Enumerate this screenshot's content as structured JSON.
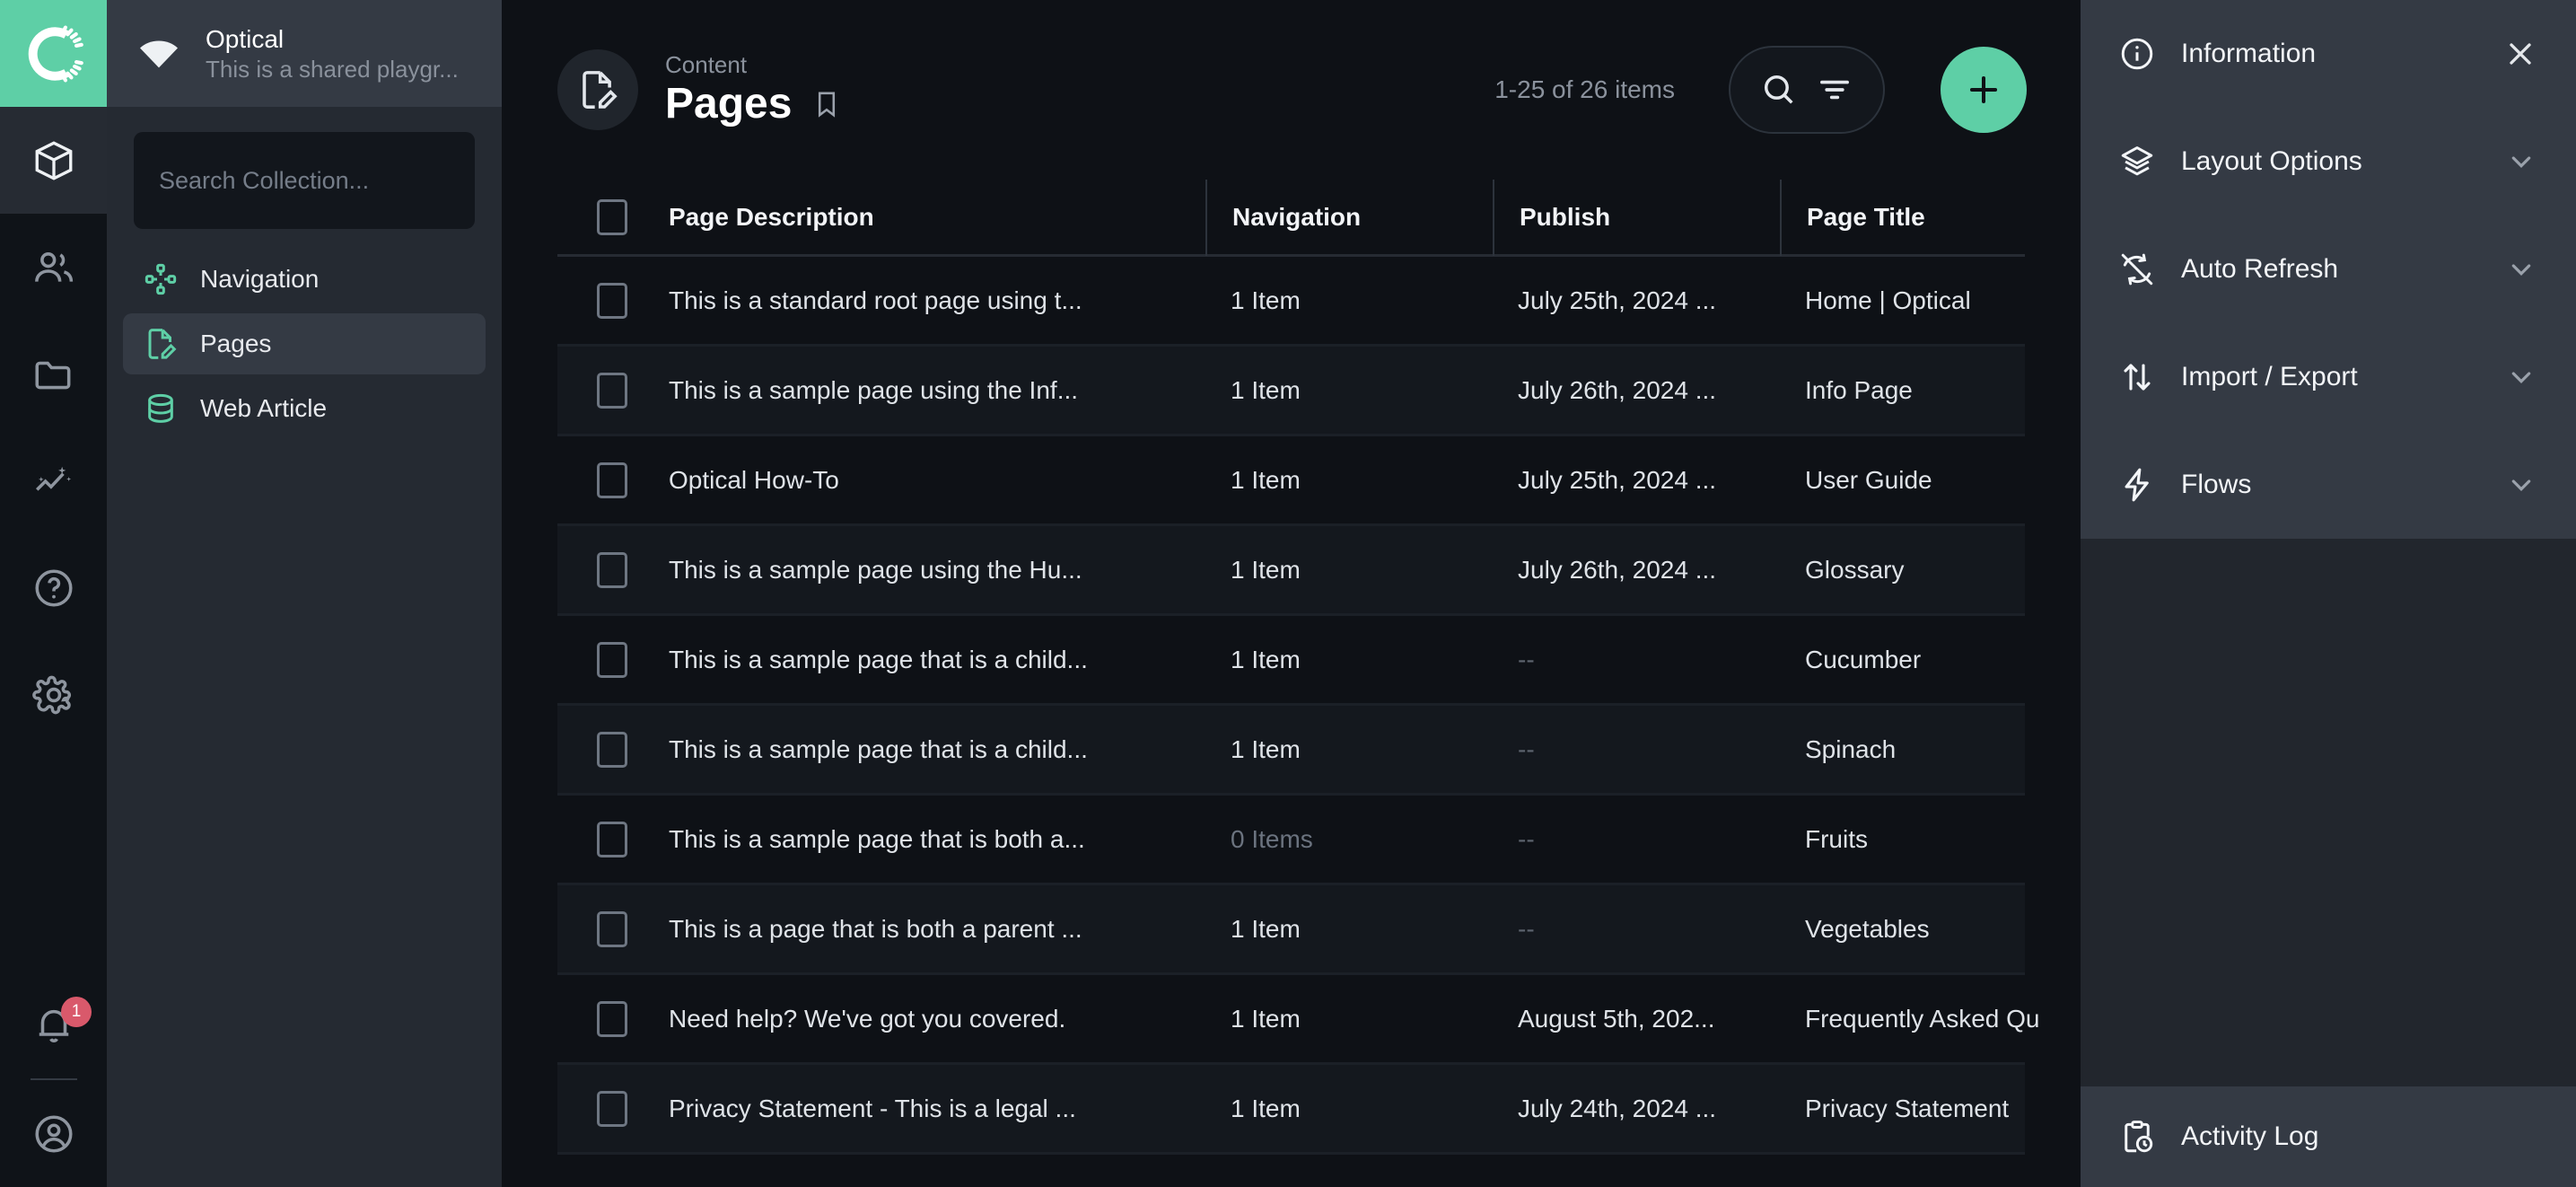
{
  "brand": {
    "logo_icon": "optical-ring-logo",
    "accent": "#5ecfa6"
  },
  "rail": {
    "items": [
      {
        "icon": "cube-icon",
        "name": "sidebar-item-collections",
        "active": true
      },
      {
        "icon": "users-icon",
        "name": "sidebar-item-users",
        "active": false
      },
      {
        "icon": "folder-icon",
        "name": "sidebar-item-files",
        "active": false
      },
      {
        "icon": "insights-icon",
        "name": "sidebar-item-insights",
        "active": false
      },
      {
        "icon": "help-circle-icon",
        "name": "sidebar-item-help",
        "active": false
      },
      {
        "icon": "gear-icon",
        "name": "sidebar-item-settings",
        "active": false
      }
    ],
    "notification_badge": "1",
    "notification_icon": "bell-icon",
    "account_icon": "account-circle-icon"
  },
  "sidebar": {
    "project_icon": "wifi-fan-icon",
    "project_name": "Optical",
    "project_subtitle": "This is a shared playgr...",
    "search_placeholder": "Search Collection...",
    "search_value": "",
    "collections": [
      {
        "label": "Navigation",
        "icon": "navigation-nodes-icon",
        "active": false
      },
      {
        "label": "Pages",
        "icon": "page-edit-icon",
        "active": true
      },
      {
        "label": "Web Article",
        "icon": "database-icon",
        "active": false
      }
    ]
  },
  "header": {
    "icon": "page-edit-icon",
    "eyebrow": "Content",
    "title": "Pages",
    "bookmark_icon": "bookmark-icon",
    "item_count": "1-25 of 26 items",
    "search_icon": "search-icon",
    "filter_icon": "filter-icon",
    "add_icon": "plus-icon"
  },
  "table": {
    "columns": [
      "Page Description",
      "Navigation",
      "Publish",
      "Page Title"
    ],
    "add_column_icon": "plus-icon",
    "rows": [
      {
        "desc": "This is a standard root page using t...",
        "nav": "1 Item",
        "nav_muted": false,
        "publish": "July 25th, 2024 ...",
        "title": "Home | Optical"
      },
      {
        "desc": "This is a sample page using the Inf...",
        "nav": "1 Item",
        "nav_muted": false,
        "publish": "July 26th, 2024 ...",
        "title": "Info Page"
      },
      {
        "desc": "Optical How-To",
        "nav": "1 Item",
        "nav_muted": false,
        "publish": "July 25th, 2024 ...",
        "title": "User Guide"
      },
      {
        "desc": "This is a sample page using the Hu...",
        "nav": "1 Item",
        "nav_muted": false,
        "publish": "July 26th, 2024 ...",
        "title": "Glossary"
      },
      {
        "desc": "This is a sample page that is a child...",
        "nav": "1 Item",
        "nav_muted": false,
        "publish": "--",
        "title": "Cucumber"
      },
      {
        "desc": "This is a sample page that is a child...",
        "nav": "1 Item",
        "nav_muted": false,
        "publish": "--",
        "title": "Spinach"
      },
      {
        "desc": "This is a sample page that is both a...",
        "nav": "0 Items",
        "nav_muted": true,
        "publish": "--",
        "title": "Fruits"
      },
      {
        "desc": "This is a page that is both a parent ...",
        "nav": "1 Item",
        "nav_muted": false,
        "publish": "--",
        "title": "Vegetables"
      },
      {
        "desc": "Need help? We've got you covered.",
        "nav": "1 Item",
        "nav_muted": false,
        "publish": "August 5th, 202...",
        "title": "Frequently Asked Qu"
      },
      {
        "desc": "Privacy Statement - This is a legal ...",
        "nav": "1 Item",
        "nav_muted": false,
        "publish": "July 24th, 2024 ...",
        "title": "Privacy Statement"
      }
    ]
  },
  "right_panel": {
    "sections": [
      {
        "label": "Information",
        "icon": "info-circle-icon",
        "trailing": "close"
      },
      {
        "label": "Layout Options",
        "icon": "layers-icon",
        "trailing": "chevron"
      },
      {
        "label": "Auto Refresh",
        "icon": "refresh-off-icon",
        "trailing": "chevron"
      },
      {
        "label": "Import / Export",
        "icon": "import-export-icon",
        "trailing": "chevron"
      },
      {
        "label": "Flows",
        "icon": "lightning-icon",
        "trailing": "chevron"
      }
    ],
    "footer": {
      "label": "Activity Log",
      "icon": "clipboard-clock-icon"
    }
  }
}
